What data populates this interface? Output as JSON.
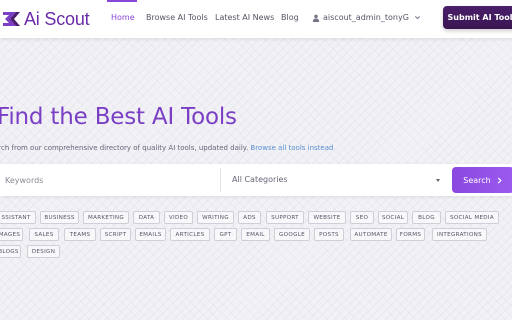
{
  "brand": {
    "name": "Ai Scout",
    "accent": "#8a48d8",
    "logo_color": "#6a2ca8"
  },
  "nav": {
    "home": "Home",
    "browse": "Browse AI Tools",
    "latest": "Latest AI News",
    "blog": "Blog",
    "user": "aiscout_admin_tonyG",
    "submit": "Submit AI Tool"
  },
  "hero": {
    "title": "Find the Best AI Tools",
    "subtitle": "arch from our comprehensive directory of quality AI tools, updated daily.",
    "browse_link": "Browse all tools instead"
  },
  "search": {
    "keyword_placeholder": "Keywords",
    "category_value": "All Categories",
    "button": "Search"
  },
  "tags": [
    "SSISTANT",
    "BUSINESS",
    "MARKETING",
    "DATA",
    "VIDEO",
    "WRITING",
    "ADS",
    "SUPPORT",
    "WEBSITE",
    "SEO",
    "SOCIAL",
    "BLOG",
    "SOCIAL MEDIA",
    "MAGES",
    "SALES",
    "TEAMS",
    "SCRIPT",
    "EMAILS",
    "ARTICLES",
    "GPT",
    "EMAIL",
    "GOOGLE",
    "POSTS",
    "AUTOMATE",
    "FORMS",
    "INTEGRATIONS",
    "BLOGS",
    "DESIGN"
  ]
}
